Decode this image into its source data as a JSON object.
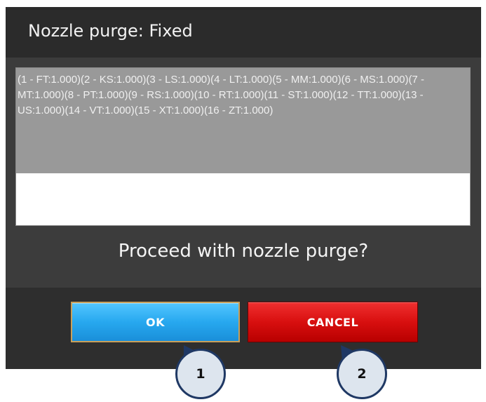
{
  "dialog": {
    "title": "Nozzle purge: Fixed",
    "details_text": "(1 - FT:1.000)(2 - KS:1.000)(3 - LS:1.000)(4 - LT:1.000)(5 - MM:1.000)(6 - MS:1.000)(7 - MT:1.000)(8 - PT:1.000)(9 - RS:1.000)(10 - RT:1.000)(11 - ST:1.000)(12 - TT:1.000)(13 - US:1.000)(14 - VT:1.000)(15 - XT:1.000)(16 - ZT:1.000)",
    "prompt": "Proceed with nozzle purge?",
    "ok_label": "OK",
    "cancel_label": "CANCEL"
  },
  "callouts": {
    "ok_number": "1",
    "cancel_number": "2"
  },
  "colors": {
    "ok_button": "#27a8ef",
    "cancel_button": "#d80f0f",
    "callout_border": "#1f3864",
    "callout_fill": "#dde5ee",
    "dialog_background": "#3a3a3a"
  }
}
